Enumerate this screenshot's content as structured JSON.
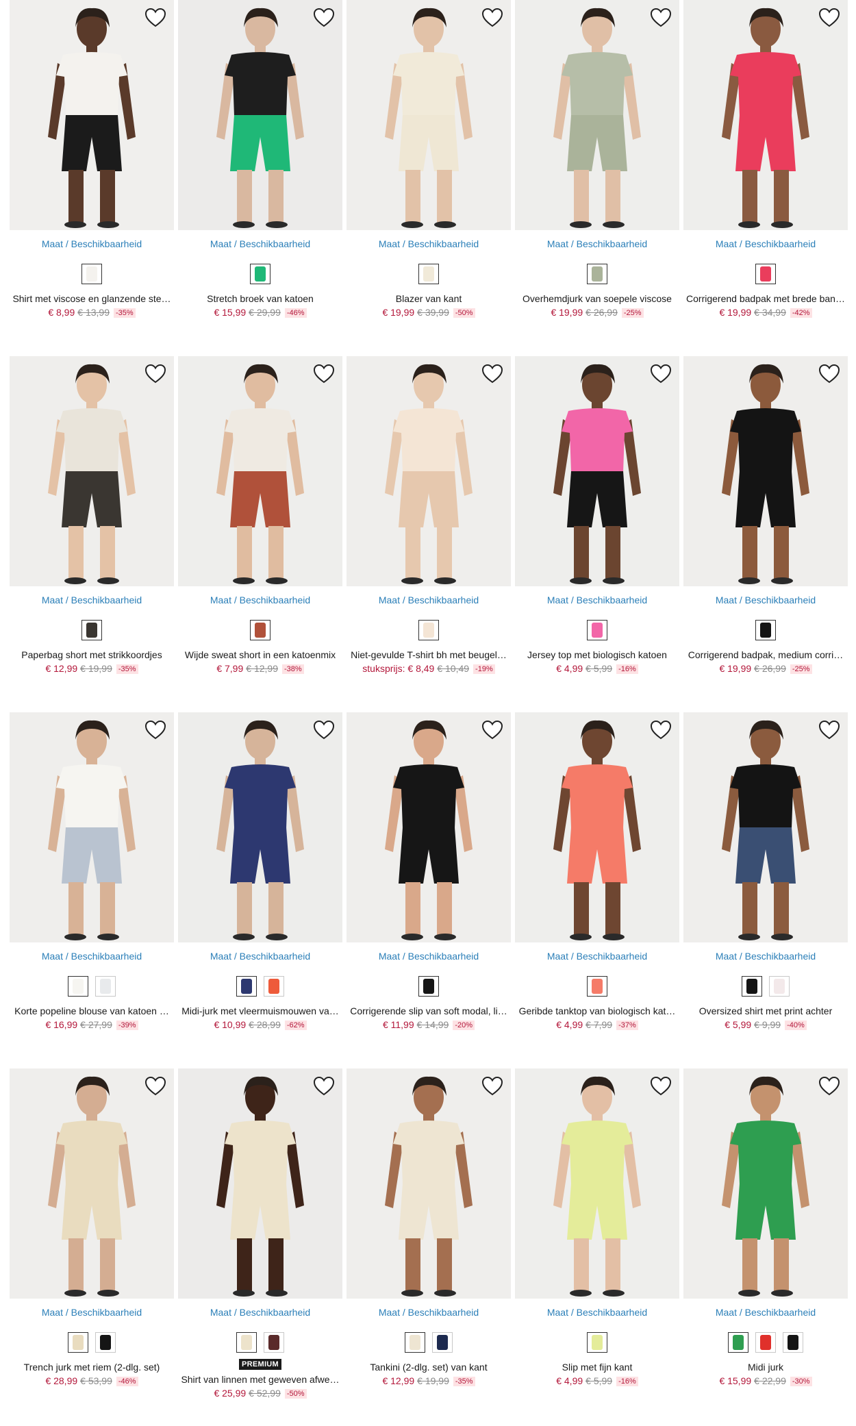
{
  "availability_label": "Maat / Beschikbaarheid",
  "products": [
    {
      "name": "Shirt met viscose en glanzende ste…",
      "price": "€ 8,99",
      "old_price": "€ 13,99",
      "discount": "-35%",
      "colors": [
        "#f4f2ee"
      ],
      "top": "#f4f2ee",
      "bottom": "#1b1b1b",
      "skin": "#5a3a2a",
      "bg": "#f0efed"
    },
    {
      "name": "Stretch broek van katoen",
      "price": "€ 15,99",
      "old_price": "€ 29,99",
      "discount": "-46%",
      "colors": [
        "#1fb877"
      ],
      "top": "#1e1e1e",
      "bottom": "#1fb877",
      "skin": "#d9b8a0",
      "bg": "#ecebea"
    },
    {
      "name": "Blazer van kant",
      "price": "€ 19,99",
      "old_price": "€ 39,99",
      "discount": "-50%",
      "colors": [
        "#f1ead9"
      ],
      "top": "#f1ead9",
      "bottom": "#efe7d4",
      "skin": "#e2c2a8",
      "bg": "#efeeec"
    },
    {
      "name": "Overhemdjurk van soepele viscose",
      "price": "€ 19,99",
      "old_price": "€ 26,99",
      "discount": "-25%",
      "colors": [
        "#aab39a"
      ],
      "top": "#b6bea8",
      "bottom": "#aab39a",
      "skin": "#e0bfa6",
      "bg": "#eeeeec"
    },
    {
      "name": "Corrigerend badpak met brede ban…",
      "price": "€ 19,99",
      "old_price": "€ 34,99",
      "discount": "-42%",
      "colors": [
        "#ea3d5c"
      ],
      "top": "#ea3d5c",
      "bottom": "#ea3d5c",
      "skin": "#8a5a40",
      "bg": "#eeeeec"
    },
    {
      "name": "Paperbag short met strikkoordjes",
      "price": "€ 12,99",
      "old_price": "€ 19,99",
      "discount": "-35%",
      "colors": [
        "#3a3631"
      ],
      "top": "#e9e4da",
      "bottom": "#3a3631",
      "skin": "#e4c2a6",
      "bg": "#efeeec"
    },
    {
      "name": "Wijde sweat short in een katoenmix",
      "price": "€ 7,99",
      "old_price": "€ 12,99",
      "discount": "-38%",
      "colors": [
        "#b0513a"
      ],
      "top": "#efeae2",
      "bottom": "#b0513a",
      "skin": "#e0bca0",
      "bg": "#eeeeec"
    },
    {
      "name": "Niet-gevulde T-shirt bh met beugel…",
      "price": "stuksprijs: € 8,49",
      "old_price": "€ 10,49",
      "discount": "-19%",
      "colors": [
        "#f4e5d5"
      ],
      "top": "#f4e5d5",
      "bottom": "#e6c8ae",
      "skin": "#e6c8ae",
      "bg": "#efeeec"
    },
    {
      "name": "Jersey top met biologisch katoen",
      "price": "€ 4,99",
      "old_price": "€ 5,99",
      "discount": "-16%",
      "colors": [
        "#f266a8"
      ],
      "top": "#f266a8",
      "bottom": "#161616",
      "skin": "#6b4530",
      "bg": "#eeeeec"
    },
    {
      "name": "Corrigerend badpak, medium corri…",
      "price": "€ 19,99",
      "old_price": "€ 26,99",
      "discount": "-25%",
      "colors": [
        "#141414"
      ],
      "top": "#141414",
      "bottom": "#141414",
      "skin": "#8c5a3c",
      "bg": "#efeeec"
    },
    {
      "name": "Korte popeline blouse van katoen …",
      "price": "€ 16,99",
      "old_price": "€ 27,99",
      "discount": "-39%",
      "colors": [
        "#f6f5f1",
        "#e8eaec"
      ],
      "top": "#f6f5f1",
      "bottom": "#b9c3d0",
      "skin": "#d8b296",
      "bg": "#efeeec"
    },
    {
      "name": "Midi-jurk met vleermuismouwen va…",
      "price": "€ 10,99",
      "old_price": "€ 28,99",
      "discount": "-62%",
      "colors": [
        "#2d3870",
        "#ee5b3a"
      ],
      "top": "#2d3870",
      "bottom": "#2d3870",
      "skin": "#d6b49a",
      "bg": "#ededeb"
    },
    {
      "name": "Corrigerende slip van soft modal, li…",
      "price": "€ 11,99",
      "old_price": "€ 14,99",
      "discount": "-20%",
      "colors": [
        "#161616"
      ],
      "top": "#161616",
      "bottom": "#161616",
      "skin": "#d9a88a",
      "bg": "#efeeec"
    },
    {
      "name": "Geribde tanktop van biologisch kat…",
      "price": "€ 4,99",
      "old_price": "€ 7,99",
      "discount": "-37%",
      "colors": [
        "#f57b68"
      ],
      "top": "#f57b68",
      "bottom": "#f57b68",
      "skin": "#6e4631",
      "bg": "#eeeeec"
    },
    {
      "name": "Oversized shirt met print achter",
      "price": "€ 5,99",
      "old_price": "€ 9,99",
      "discount": "-40%",
      "colors": [
        "#141414",
        "#f3e9ea"
      ],
      "top": "#141414",
      "bottom": "#3a4f73",
      "skin": "#8b5b3e",
      "bg": "#efeeec"
    },
    {
      "name": "Trench jurk met riem (2-dlg. set)",
      "price": "€ 28,99",
      "old_price": "€ 53,99",
      "discount": "-46%",
      "colors": [
        "#e9dcbf",
        "#151515"
      ],
      "top": "#e9dcbf",
      "bottom": "#e9dcbf",
      "skin": "#d4ad92",
      "bg": "#efeeec"
    },
    {
      "name": "Shirt van linnen met geweven afwe…",
      "price": "€ 25,99",
      "old_price": "€ 52,99",
      "discount": "-50%",
      "badge": "PREMIUM",
      "colors": [
        "#ede3cb",
        "#5a2a2a"
      ],
      "top": "#ede3cb",
      "bottom": "#ede3cb",
      "skin": "#3e2419",
      "bg": "#ecebea"
    },
    {
      "name": "Tankini (2-dlg. set) van kant",
      "price": "€ 12,99",
      "old_price": "€ 19,99",
      "discount": "-35%",
      "colors": [
        "#eee5d2",
        "#1d2a4f"
      ],
      "top": "#eee5d2",
      "bottom": "#eee5d2",
      "skin": "#a46f50",
      "bg": "#efeeec"
    },
    {
      "name": "Slip met fijn kant",
      "price": "€ 4,99",
      "old_price": "€ 5,99",
      "discount": "-16%",
      "colors": [
        "#e4ec9a"
      ],
      "top": "#e4ec9a",
      "bottom": "#e4ec9a",
      "skin": "#e3bfa5",
      "bg": "#eeeeec"
    },
    {
      "name": "Midi jurk",
      "price": "€ 15,99",
      "old_price": "€ 22,99",
      "discount": "-30%",
      "colors": [
        "#2e9e50",
        "#e0302b",
        "#141414"
      ],
      "top": "#2e9e50",
      "bottom": "#2e9e50",
      "skin": "#c4926e",
      "bg": "#efeeec"
    }
  ]
}
